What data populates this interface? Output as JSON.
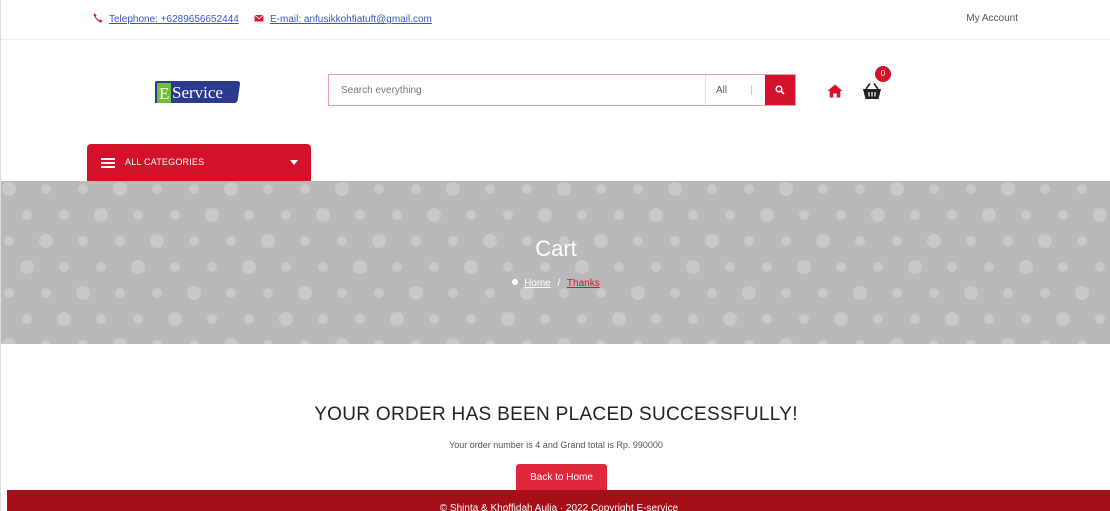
{
  "topbar": {
    "phone": "Telephone: +6289656652444",
    "email": "E-mail: anfusikkohfiatuft@gmail.com",
    "account": "My Account"
  },
  "header": {
    "logo_text": "Service",
    "logo_letter": "E",
    "search_placeholder": "Search everything",
    "search_category": "All",
    "cart_count": "0"
  },
  "categories": {
    "label": "ALL CATEGORIES"
  },
  "banner": {
    "title": "Cart",
    "breadcrumb_home": "Home",
    "breadcrumb_separator": "/",
    "breadcrumb_current": "Thanks"
  },
  "content": {
    "message": "YOUR ORDER HAS BEEN PLACED SUCCESSFULLY!",
    "details": "Your order number is 4 and Grand total is Rp. 990000",
    "back_button": "Back to Home"
  },
  "footer": {
    "copyright": "© Shinta & Khoffidah Aulia · 2022 Copyright E-service"
  },
  "colors": {
    "accent": "#d3122a",
    "banner_bg": "#b9b9b9",
    "footer_bg": "#a50f18",
    "link": "#3a55c8",
    "logo_blue": "#2b3a8c",
    "logo_green": "#6fbf3b"
  }
}
